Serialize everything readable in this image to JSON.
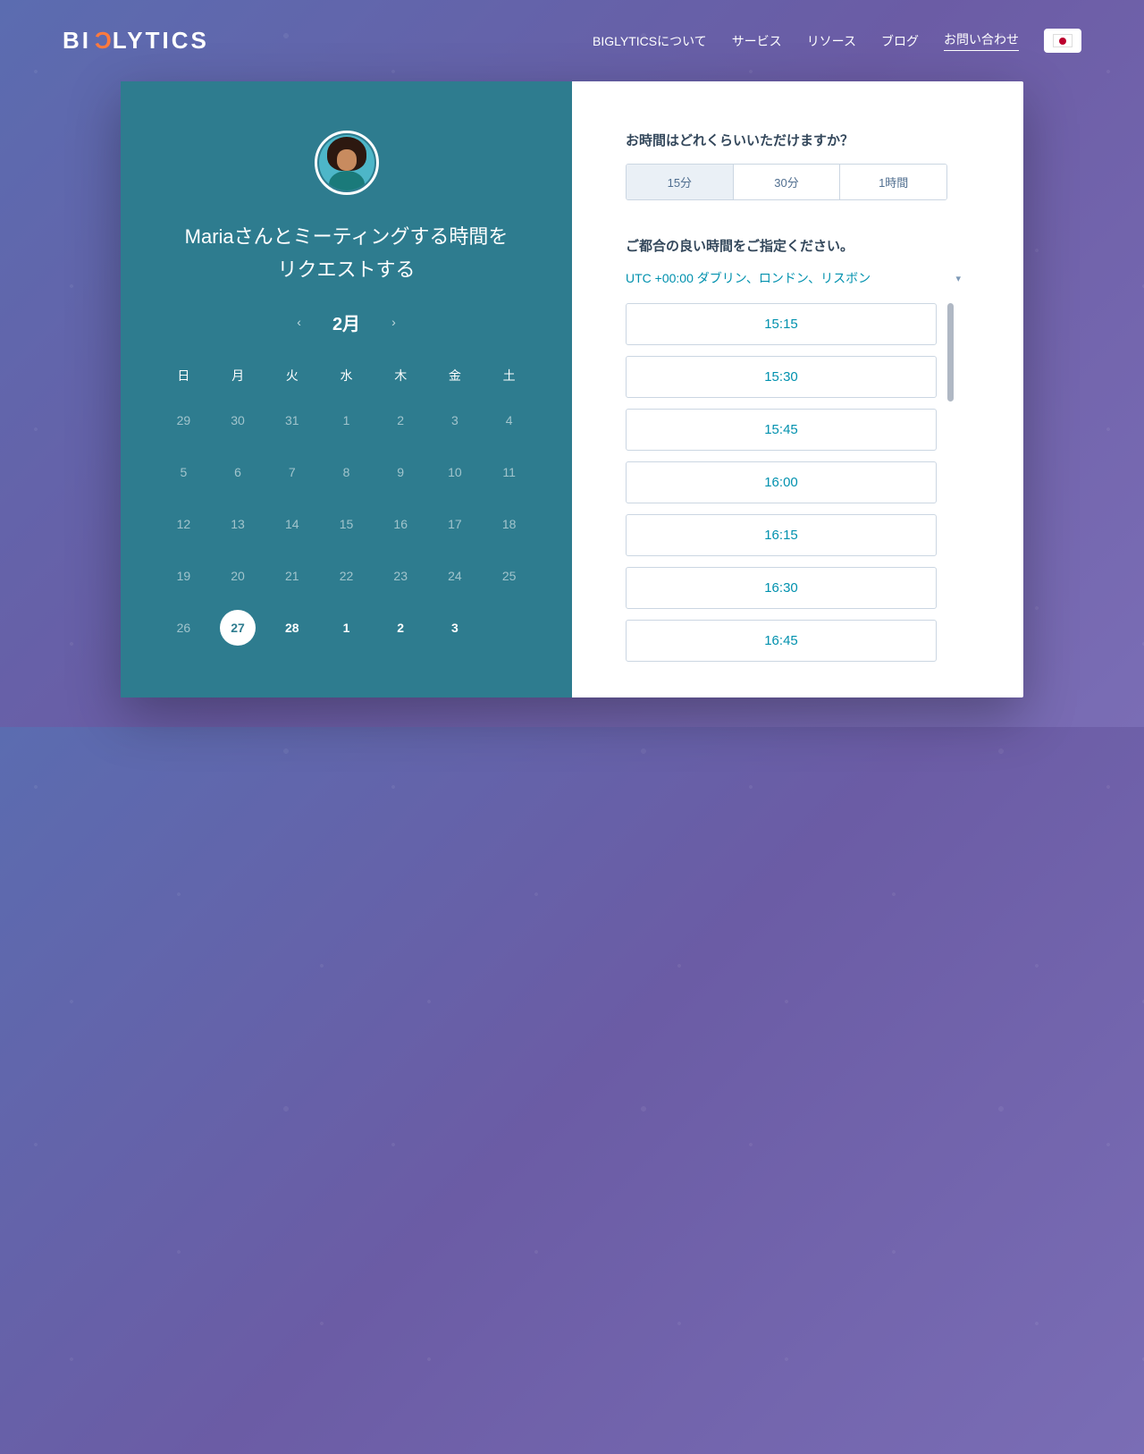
{
  "header": {
    "logo_prefix": "BI",
    "logo_accent": "C",
    "logo_suffix": "LYTICS",
    "nav": [
      {
        "label": "BIGLYTICSについて",
        "active": false
      },
      {
        "label": "サービス",
        "active": false
      },
      {
        "label": "リソース",
        "active": false
      },
      {
        "label": "ブログ",
        "active": false
      },
      {
        "label": "お問い合わせ",
        "active": true
      }
    ],
    "flag": "jp"
  },
  "meeting": {
    "title_line1": "Mariaさんとミーティングする時間を",
    "title_line2": "リクエストする",
    "month_label": "2月",
    "days_of_week": [
      "日",
      "月",
      "火",
      "水",
      "木",
      "金",
      "土"
    ],
    "weeks": [
      [
        {
          "d": "29",
          "cm": false
        },
        {
          "d": "30",
          "cm": false
        },
        {
          "d": "31",
          "cm": false
        },
        {
          "d": "1",
          "cm": false
        },
        {
          "d": "2",
          "cm": false
        },
        {
          "d": "3",
          "cm": false
        },
        {
          "d": "4",
          "cm": false
        }
      ],
      [
        {
          "d": "5",
          "cm": false
        },
        {
          "d": "6",
          "cm": false
        },
        {
          "d": "7",
          "cm": false
        },
        {
          "d": "8",
          "cm": false
        },
        {
          "d": "9",
          "cm": false
        },
        {
          "d": "10",
          "cm": false
        },
        {
          "d": "11",
          "cm": false
        }
      ],
      [
        {
          "d": "12",
          "cm": false
        },
        {
          "d": "13",
          "cm": false
        },
        {
          "d": "14",
          "cm": false
        },
        {
          "d": "15",
          "cm": false
        },
        {
          "d": "16",
          "cm": false
        },
        {
          "d": "17",
          "cm": false
        },
        {
          "d": "18",
          "cm": false
        }
      ],
      [
        {
          "d": "19",
          "cm": false
        },
        {
          "d": "20",
          "cm": false
        },
        {
          "d": "21",
          "cm": false
        },
        {
          "d": "22",
          "cm": false
        },
        {
          "d": "23",
          "cm": false
        },
        {
          "d": "24",
          "cm": false
        },
        {
          "d": "25",
          "cm": false
        }
      ],
      [
        {
          "d": "26",
          "cm": false
        },
        {
          "d": "27",
          "cm": true,
          "sel": true
        },
        {
          "d": "28",
          "cm": true
        },
        {
          "d": "1",
          "cm": true
        },
        {
          "d": "2",
          "cm": true
        },
        {
          "d": "3",
          "cm": true
        },
        {
          "d": "",
          "cm": false
        }
      ]
    ]
  },
  "schedule": {
    "duration_title": "お時間はどれくらいいただけますか？",
    "durations": [
      {
        "label": "15分",
        "active": true
      },
      {
        "label": "30分",
        "active": false
      },
      {
        "label": "1時間",
        "active": false
      }
    ],
    "time_title": "ご都合の良い時間をご指定ください。",
    "timezone": "UTC +00:00 ダブリン、ロンドン、リスボン",
    "slots": [
      "15:15",
      "15:30",
      "15:45",
      "16:00",
      "16:15",
      "16:30",
      "16:45"
    ]
  }
}
